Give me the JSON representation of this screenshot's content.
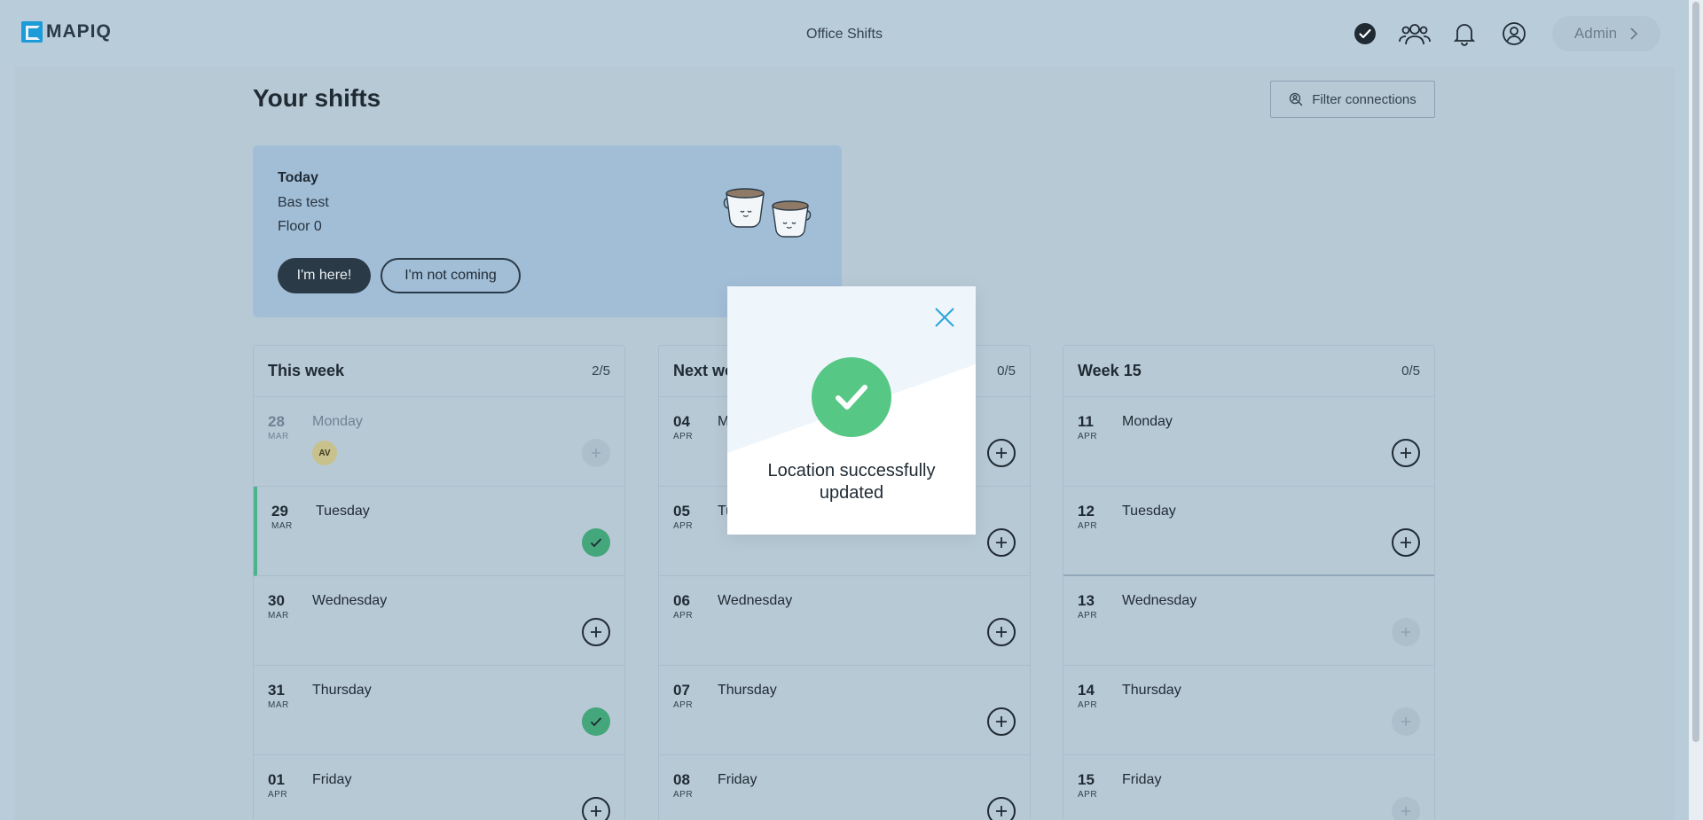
{
  "app": {
    "logo_text": "MAPIQ",
    "title": "Office Shifts",
    "admin_label": "Admin"
  },
  "page": {
    "title": "Your shifts",
    "filter_label": "Filter connections"
  },
  "today": {
    "label": "Today",
    "location": "Bas test",
    "floor": "Floor 0",
    "here_label": "I'm here!",
    "not_coming_label": "I'm not coming"
  },
  "weeks": [
    {
      "title": "This week",
      "count": "2/5",
      "days": [
        {
          "num": "28",
          "mon": "MAR",
          "name": "Monday",
          "state": "past",
          "action": "plus-dim",
          "avatar": "AV"
        },
        {
          "num": "29",
          "mon": "MAR",
          "name": "Tuesday",
          "state": "current",
          "action": "check"
        },
        {
          "num": "30",
          "mon": "MAR",
          "name": "Wednesday",
          "state": "normal",
          "action": "plus"
        },
        {
          "num": "31",
          "mon": "MAR",
          "name": "Thursday",
          "state": "normal",
          "action": "check"
        },
        {
          "num": "01",
          "mon": "APR",
          "name": "Friday",
          "state": "normal",
          "action": "plus"
        }
      ]
    },
    {
      "title": "Next we",
      "count": "0/5",
      "days": [
        {
          "num": "04",
          "mon": "APR",
          "name": "M",
          "state": "normal",
          "action": "plus"
        },
        {
          "num": "05",
          "mon": "APR",
          "name": "Tu",
          "state": "normal",
          "action": "plus"
        },
        {
          "num": "06",
          "mon": "APR",
          "name": "Wednesday",
          "state": "normal",
          "action": "plus"
        },
        {
          "num": "07",
          "mon": "APR",
          "name": "Thursday",
          "state": "normal",
          "action": "plus"
        },
        {
          "num": "08",
          "mon": "APR",
          "name": "Friday",
          "state": "normal",
          "action": "plus"
        }
      ]
    },
    {
      "title": "Week 15",
      "count": "0/5",
      "days": [
        {
          "num": "11",
          "mon": "APR",
          "name": "Monday",
          "state": "normal",
          "action": "plus"
        },
        {
          "num": "12",
          "mon": "APR",
          "name": "Tuesday",
          "state": "normal",
          "action": "plus"
        },
        {
          "num": "13",
          "mon": "APR",
          "name": "Wednesday",
          "state": "normal",
          "action": "plus-dim"
        },
        {
          "num": "14",
          "mon": "APR",
          "name": "Thursday",
          "state": "normal",
          "action": "plus-dim"
        },
        {
          "num": "15",
          "mon": "APR",
          "name": "Friday",
          "state": "normal",
          "action": "plus-dim"
        }
      ]
    }
  ],
  "modal": {
    "message": "Location successfully updated"
  },
  "colors": {
    "accent_blue": "#1b9bd8",
    "success_green": "#56c785",
    "check_green": "#44a67b"
  }
}
